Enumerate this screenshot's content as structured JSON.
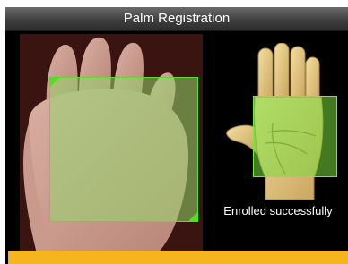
{
  "window": {
    "title": "Palm Registration"
  },
  "camera_view": {
    "scan_region": "palm-scan-frame"
  },
  "guide": {
    "icon": "hand-icon"
  },
  "status": {
    "message": "Enrolled successfully"
  },
  "colors": {
    "titlebar": "#3c3c3c",
    "scan_frame": "#5adc34",
    "bottom_bar": "#f6b51f",
    "background": "#000000"
  }
}
